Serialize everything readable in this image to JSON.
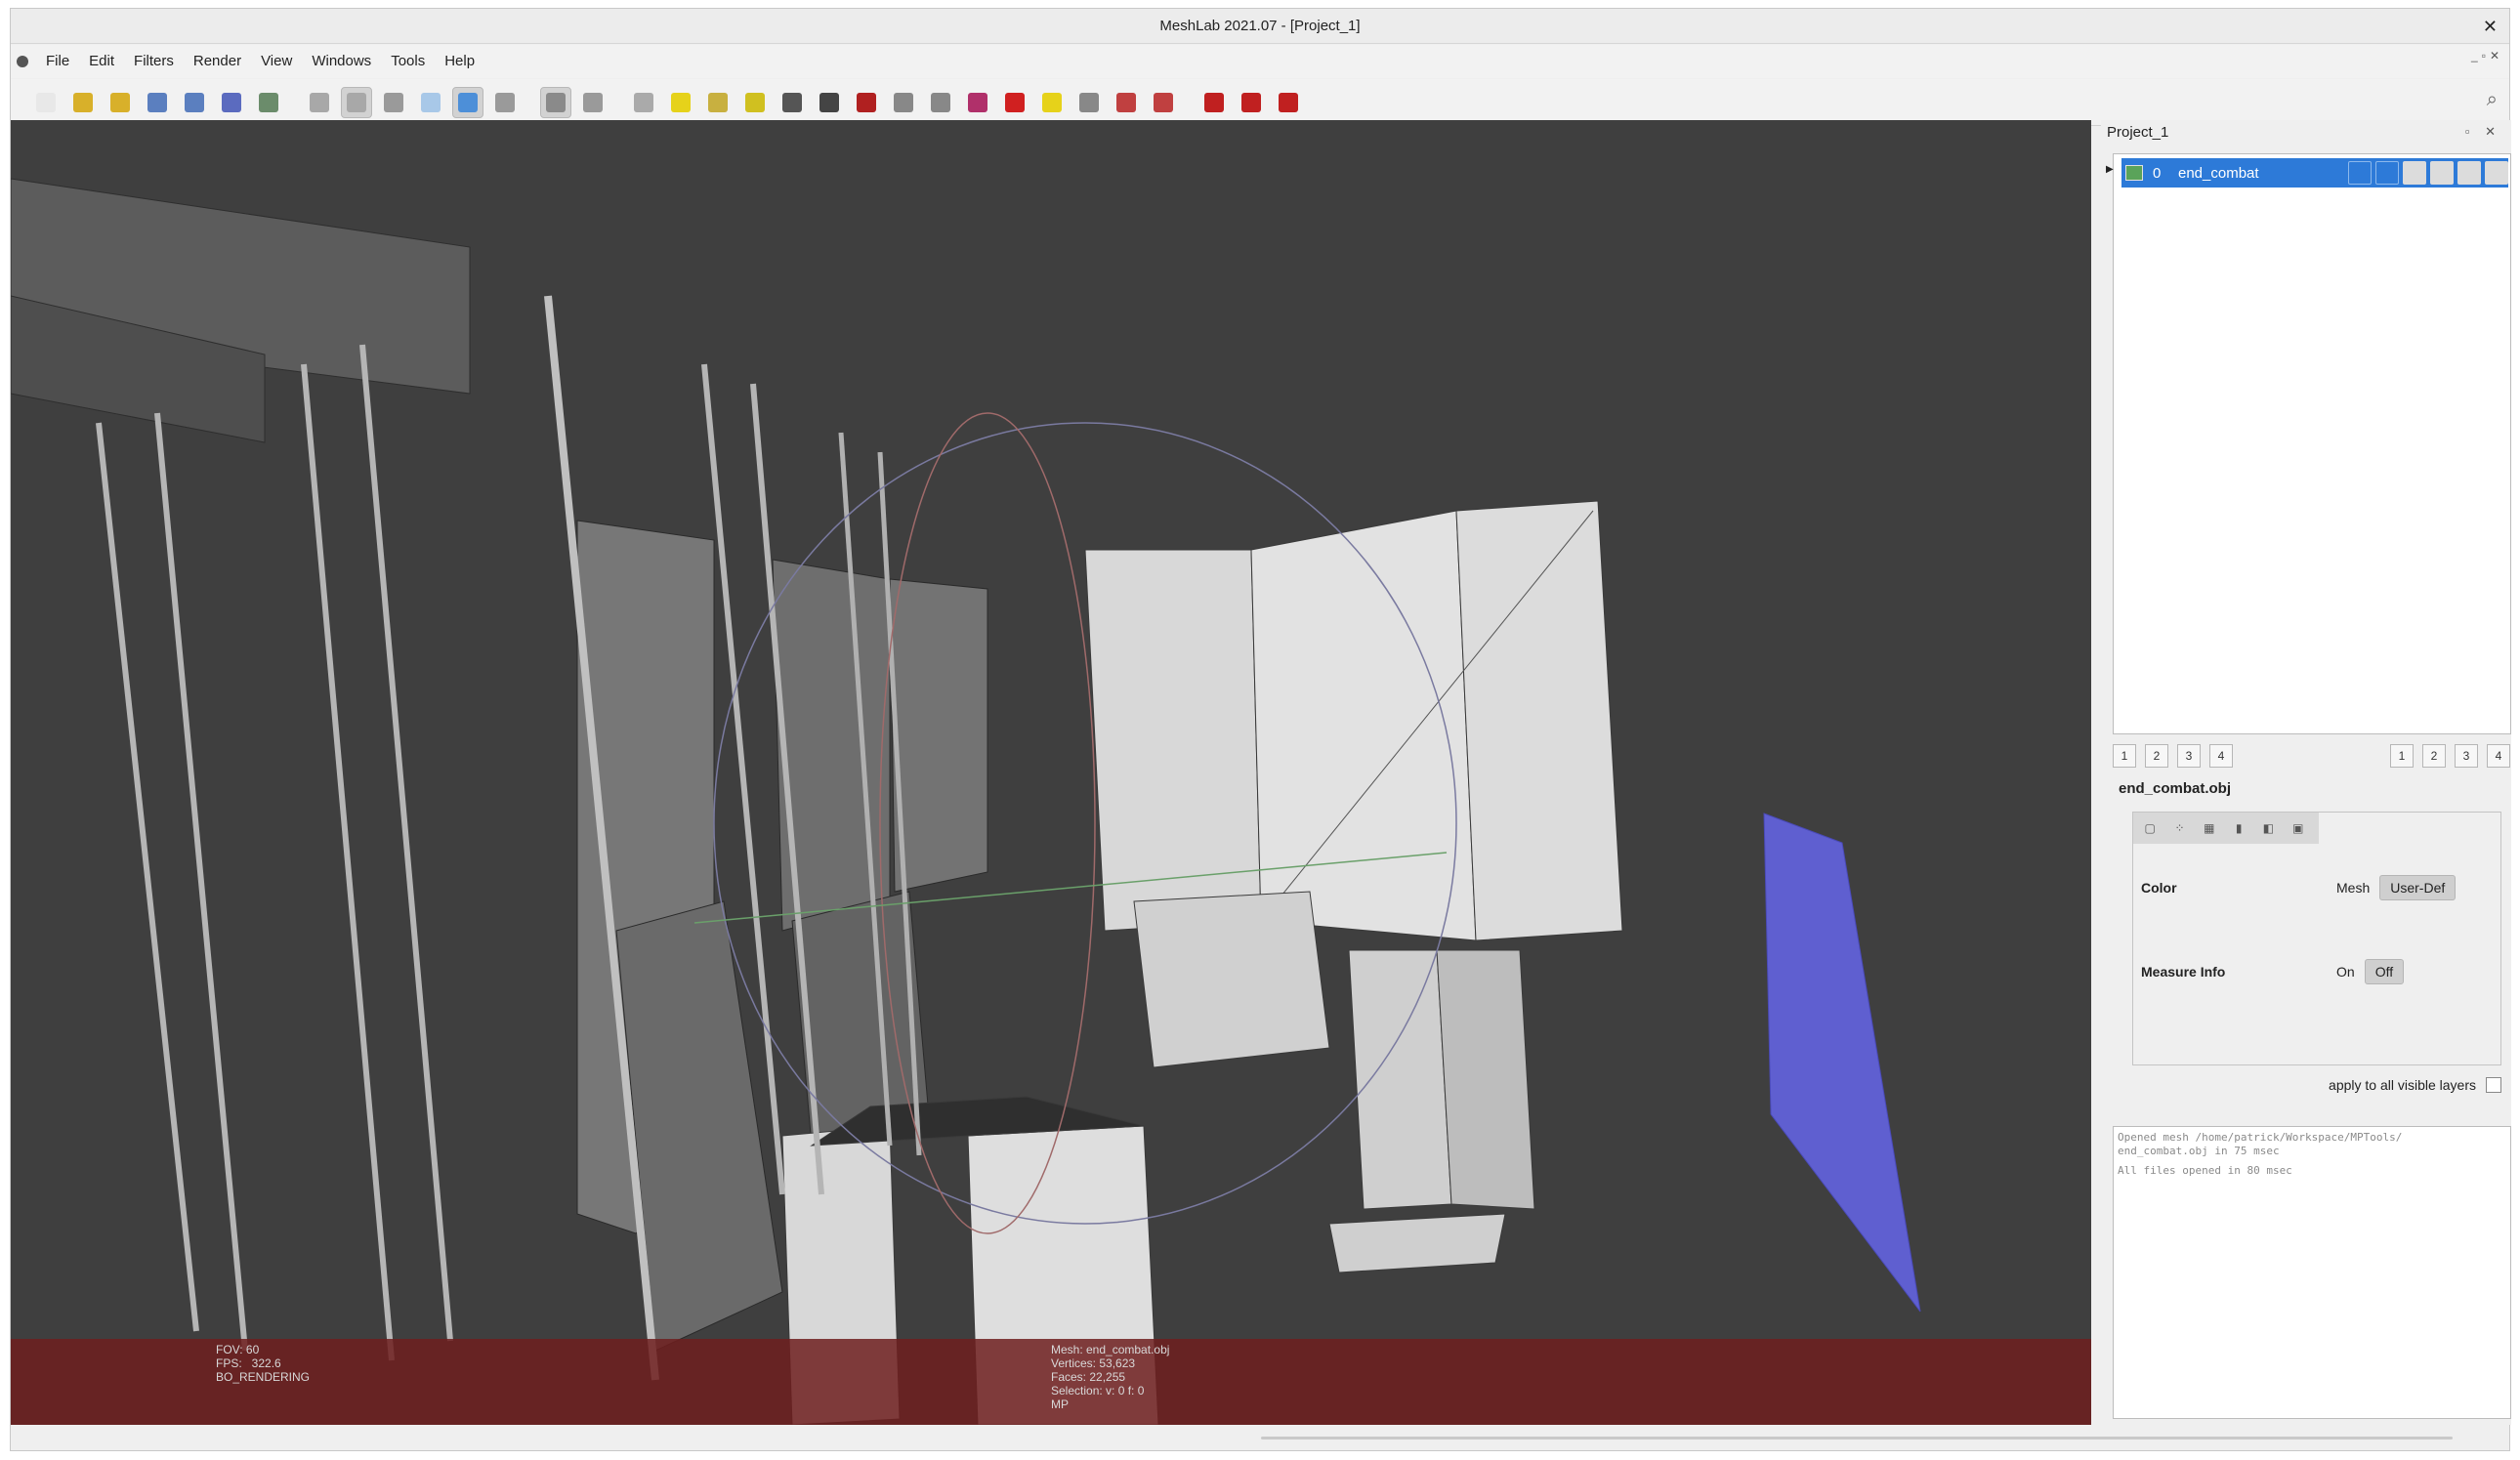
{
  "window": {
    "title": "MeshLab 2021.07 - [Project_1]",
    "close_glyph": "✕"
  },
  "menu": {
    "items": [
      "File",
      "Edit",
      "Filters",
      "Render",
      "View",
      "Windows",
      "Tools",
      "Help"
    ]
  },
  "toolbar": {
    "icons": [
      "new-project-icon",
      "open-icon",
      "open-project-icon",
      "reload-icon",
      "reload-all-icon",
      "save-icon",
      "snapshot-icon",
      "bbox-icon",
      "points-icon",
      "wireframe-icon",
      "flat-lines-icon",
      "flat-icon",
      "smooth-icon",
      "lighting-icon",
      "doublesided-icon",
      "trackball-icon",
      "annotation-icon",
      "axis-icon",
      "align-icon",
      "paint-icon",
      "pick-icon",
      "texture-icon",
      "select-faces-icon",
      "select-vertices-icon",
      "select-component-icon",
      "measure-icon",
      "info-icon",
      "manip-icon",
      "select-region-icon",
      "select-polygon-icon",
      "delete-faces-icon",
      "delete-vertices-icon",
      "delete-all-icon"
    ],
    "active_indices": [
      8,
      11,
      13
    ]
  },
  "viewport": {
    "overlay_left": "FOV: 60\nFPS:   322.6\nBO_RENDERING",
    "overlay_center": "Mesh: end_combat.obj\nVertices: 53,623\nFaces: 22,255\nSelection: v: 0 f: 0\nMP",
    "bar_color": "#6e1e1e",
    "background": "#3f3f3f"
  },
  "panel": {
    "title": "Project_1",
    "buttons": "▫ ✕",
    "layer": {
      "index": "0",
      "name": "end_combat",
      "color": "#2d7ad8"
    },
    "view_buttons_left": [
      "1",
      "2",
      "3",
      "4"
    ],
    "view_buttons_right": [
      "1",
      "2",
      "3",
      "4"
    ],
    "file_label": "end_combat.obj",
    "props": {
      "color_label": "Color",
      "color_mesh": "Mesh",
      "color_userdef": "User-Def",
      "measure_label": "Measure Info",
      "measure_on": "On",
      "measure_off": "Off"
    },
    "apply_label": "apply to all visible layers",
    "log": [
      "Opened mesh /home/patrick/Workspace/MPTools/\nend_combat.obj in 75 msec",
      "All files opened in 80 msec"
    ]
  }
}
